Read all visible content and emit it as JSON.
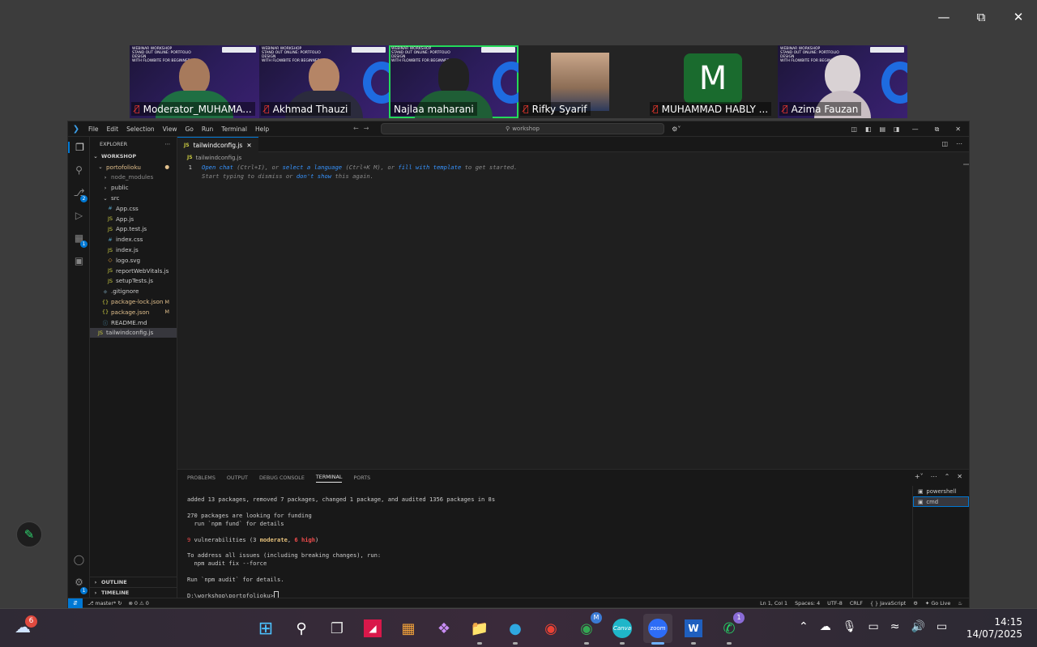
{
  "zoom": {
    "participants": [
      {
        "name": "Moderator_MUHAMA...",
        "muted": true,
        "type": "video-slide"
      },
      {
        "name": "Akhmad Thauzi",
        "muted": true,
        "type": "video-slide"
      },
      {
        "name": "Najlaa maharani",
        "muted": false,
        "type": "video-slide",
        "active": true
      },
      {
        "name": "Rifky Syarif",
        "muted": true,
        "type": "photo"
      },
      {
        "name": "MUHAMMAD HABLY ...",
        "muted": true,
        "type": "avatar",
        "initial": "M"
      },
      {
        "name": "Azima Fauzan",
        "muted": true,
        "type": "video-slide"
      }
    ],
    "slide_title": "WEBINAR WORKSHOP\nSTAND OUT ONLINE: PORTFOLIO DESIGN\nWITH FLOWBITE FOR BEGINNERS"
  },
  "vscode": {
    "menu": [
      "File",
      "Edit",
      "Selection",
      "View",
      "Go",
      "Run",
      "Terminal",
      "Help"
    ],
    "search_text": "workshop",
    "explorer_title": "EXPLORER",
    "workspace": "WORKSHOP",
    "tree": [
      {
        "label": "portofolioku",
        "icon": "chevron-down",
        "indent": 1,
        "status": "●",
        "color": "#e2c08d"
      },
      {
        "label": "node_modules",
        "icon": "chevron-right",
        "indent": 2,
        "color": "#8c8c8c"
      },
      {
        "label": "public",
        "icon": "chevron-right",
        "indent": 2
      },
      {
        "label": "src",
        "icon": "chevron-down",
        "indent": 2
      },
      {
        "label": "App.css",
        "icon": "#",
        "indent": 3,
        "iconColor": "#519aba"
      },
      {
        "label": "App.js",
        "icon": "JS",
        "indent": 3,
        "iconColor": "#cbcb41"
      },
      {
        "label": "App.test.js",
        "icon": "JS",
        "indent": 3,
        "iconColor": "#cbcb41"
      },
      {
        "label": "index.css",
        "icon": "#",
        "indent": 3,
        "iconColor": "#519aba"
      },
      {
        "label": "index.js",
        "icon": "JS",
        "indent": 3,
        "iconColor": "#cbcb41"
      },
      {
        "label": "logo.svg",
        "icon": "◇",
        "indent": 3,
        "iconColor": "#ffb13b"
      },
      {
        "label": "reportWebVitals.js",
        "icon": "JS",
        "indent": 3,
        "iconColor": "#cbcb41"
      },
      {
        "label": "setupTests.js",
        "icon": "JS",
        "indent": 3,
        "iconColor": "#cbcb41"
      },
      {
        "label": ".gitignore",
        "icon": "◆",
        "indent": 2,
        "iconColor": "#41535b"
      },
      {
        "label": "package-lock.json",
        "icon": "{}",
        "indent": 2,
        "iconColor": "#cbcb41",
        "status": "M",
        "color": "#e2c08d"
      },
      {
        "label": "package.json",
        "icon": "{}",
        "indent": 2,
        "iconColor": "#cbcb41",
        "status": "M",
        "color": "#e2c08d"
      },
      {
        "label": "README.md",
        "icon": "ⓘ",
        "indent": 2,
        "iconColor": "#519aba"
      },
      {
        "label": "tailwindconfig.js",
        "icon": "JS",
        "indent": 1,
        "iconColor": "#cbcb41",
        "selected": true
      }
    ],
    "outline_label": "OUTLINE",
    "timeline_label": "TIMELINE",
    "tab_label": "tailwindconfig.js",
    "breadcrumb": "tailwindconfig.js",
    "editor": {
      "line1_num": "1",
      "open_chat": "Open chat",
      "open_chat_key": " (Ctrl+I), or ",
      "select_language": "select a language",
      "select_language_key": " (Ctrl+K M), or ",
      "fill_template": "fill with template",
      "line1_tail": " to get started.",
      "line2_a": "Start typing to dismiss or ",
      "dont_show": "don't show",
      "line2_b": " this again."
    },
    "panel_tabs": [
      "PROBLEMS",
      "OUTPUT",
      "DEBUG CONSOLE",
      "TERMINAL",
      "PORTS"
    ],
    "terminal": {
      "line1": "added 13 packages, removed 7 packages, changed 1 package, and audited 1356 packages in 8s",
      "line2": "270 packages are looking for funding",
      "line3": "  run `npm fund` for details",
      "vuln_num": "9",
      "vuln_a": " vulnerabilities (3 ",
      "vuln_moderate": "moderate",
      "vuln_b": ", ",
      "vuln_high": "6 high",
      "vuln_c": ")",
      "line5": "To address all issues (including breaking changes), run:",
      "line6": "  npm audit fix --force",
      "line7": "Run `npm audit` for details.",
      "prompt": "D:\\workshop\\portofolioku>"
    },
    "terminals": [
      "powershell",
      "cmd"
    ],
    "status": {
      "branch": "master*",
      "problems": "⊗ 0 ⚠ 0",
      "position": "Ln 1, Col 1",
      "spaces": "Spaces: 4",
      "encoding": "UTF-8",
      "eol": "CRLF",
      "language": "{ } JavaScript",
      "golive": "Go Live"
    }
  },
  "taskbar": {
    "weather_badge": "6",
    "chrome_badge": "M",
    "whatsapp_badge": "1",
    "time": "14:15",
    "date": "14/07/2025"
  }
}
